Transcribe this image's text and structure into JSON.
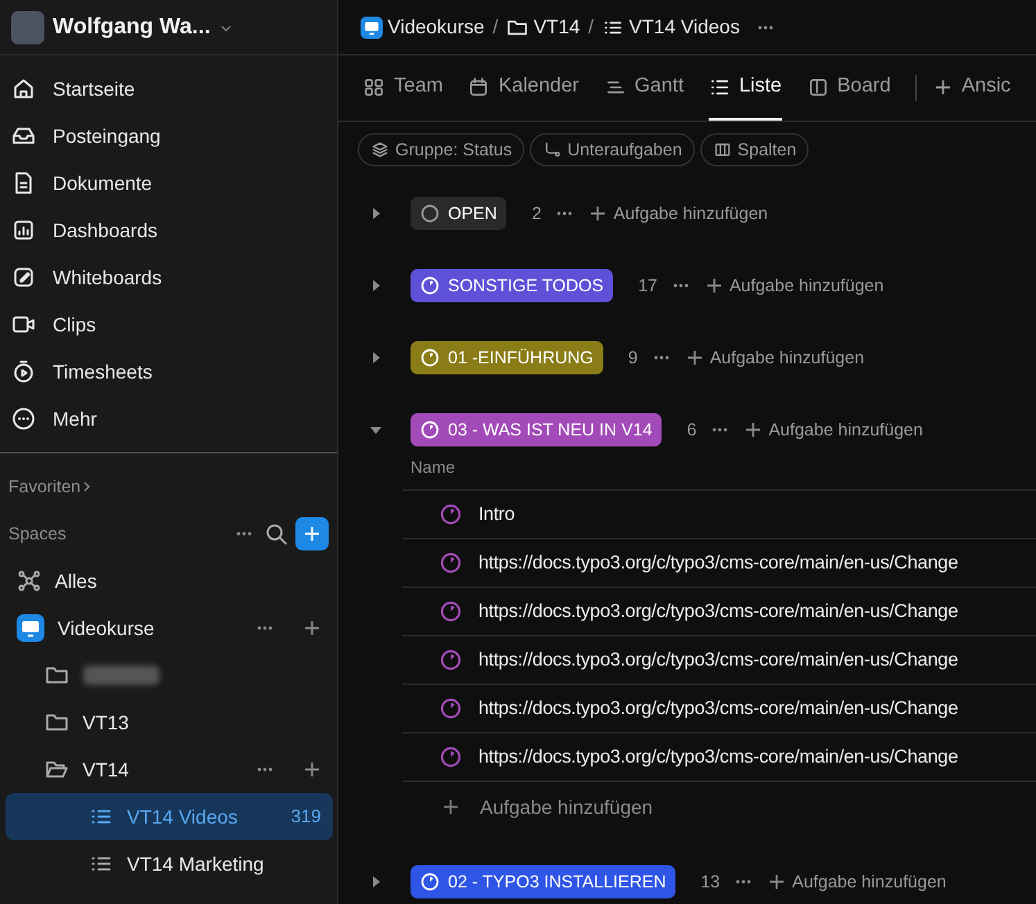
{
  "workspace": {
    "name": "Wolfgang Wa..."
  },
  "nav": [
    {
      "label": "Startseite"
    },
    {
      "label": "Posteingang"
    },
    {
      "label": "Dokumente"
    },
    {
      "label": "Dashboards"
    },
    {
      "label": "Whiteboards"
    },
    {
      "label": "Clips"
    },
    {
      "label": "Timesheets"
    },
    {
      "label": "Mehr"
    }
  ],
  "favorites": {
    "label": "Favoriten"
  },
  "spaces": {
    "label": "Spaces",
    "items": [
      {
        "kind": "all",
        "label": "Alles"
      },
      {
        "kind": "space",
        "label": "Videokurse",
        "children": [
          {
            "kind": "folder",
            "redacted": true,
            "expanded": false
          },
          {
            "kind": "folder",
            "label": "VT13",
            "redacted": false,
            "expanded": false
          },
          {
            "kind": "folder",
            "label": "VT14",
            "redacted": false,
            "expanded": true,
            "children": [
              {
                "kind": "list",
                "label": "VT14 Videos",
                "count": "319",
                "selected": true
              },
              {
                "kind": "list",
                "label": "VT14 Marketing",
                "selected": false
              }
            ]
          }
        ]
      }
    ]
  },
  "breadcrumb_separator": "/",
  "breadcrumb": [
    {
      "kind": "space",
      "label": "Videokurse"
    },
    {
      "kind": "folder",
      "label": "VT14"
    },
    {
      "kind": "list",
      "label": "VT14 Videos"
    }
  ],
  "views": [
    {
      "label": "Team",
      "selected": false
    },
    {
      "label": "Kalender",
      "selected": false
    },
    {
      "label": "Gantt",
      "selected": false
    },
    {
      "label": "Liste",
      "selected": true
    },
    {
      "label": "Board",
      "selected": false
    }
  ],
  "add_view": {
    "label": "Ansic"
  },
  "filters": [
    {
      "label": "Gruppe: Status"
    },
    {
      "label": "Unteraufgaben"
    },
    {
      "label": "Spalten"
    }
  ],
  "groups": [
    {
      "label": "OPEN",
      "count": "2",
      "color": "#2a2a2a",
      "expanded": false,
      "add_label": "Aufgabe hinzufügen"
    },
    {
      "label": "SONSTIGE TODOS",
      "count": "17",
      "color": "#5f50d8",
      "expanded": false,
      "add_label": "Aufgabe hinzufügen"
    },
    {
      "label": "01 -EINFÜHRUNG",
      "count": "9",
      "color": "#8a7c16",
      "expanded": false,
      "add_label": "Aufgabe hinzufügen"
    },
    {
      "label": "03 - WAS IST NEU IN V14",
      "count": "6",
      "color": "#a24bb8",
      "expanded": true,
      "add_label": "Aufgabe hinzufügen",
      "column": "Name",
      "tasks": [
        {
          "name": "Intro"
        },
        {
          "name": "https://docs.typo3.org/c/typo3/cms-core/main/en-us/Change"
        },
        {
          "name": "https://docs.typo3.org/c/typo3/cms-core/main/en-us/Change"
        },
        {
          "name": "https://docs.typo3.org/c/typo3/cms-core/main/en-us/Change"
        },
        {
          "name": "https://docs.typo3.org/c/typo3/cms-core/main/en-us/Change"
        },
        {
          "name": "https://docs.typo3.org/c/typo3/cms-core/main/en-us/Change"
        }
      ],
      "add_row_label": "Aufgabe hinzufügen"
    },
    {
      "label": "02 - TYPO3 INSTALLIEREN",
      "count": "13",
      "color": "#2f55e6",
      "expanded": false,
      "add_label": "Aufgabe hinzufügen"
    }
  ]
}
